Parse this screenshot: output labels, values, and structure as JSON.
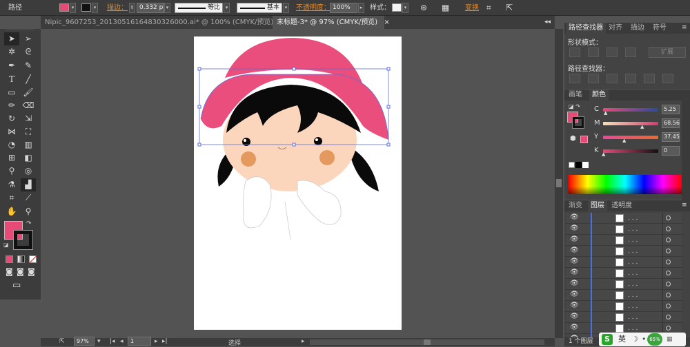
{
  "control_bar": {
    "object_type": "路径",
    "stroke_label": "描边：",
    "stroke_weight": "0.332 p",
    "profile_label": "等比",
    "brush_label": "基本",
    "opacity_label": "不透明度：",
    "opacity_value": "100%",
    "style_label": "样式：",
    "transform_label": "变换",
    "fill_color": "#e84a78"
  },
  "document_tabs": [
    {
      "label": "Nipic_9607253_20130516164830326000.ai* @ 100% (CMYK/预览)",
      "close": "×"
    },
    {
      "label": "未标题-3* @ 97% (CMYK/预览)",
      "close": "×"
    }
  ],
  "pathfinder_panel": {
    "tabs": [
      "路径查找器",
      "对齐",
      "描边",
      "符号"
    ],
    "shape_modes_label": "形状模式：",
    "expand_label": "扩展",
    "pathfinders_label": "路径查找器："
  },
  "color_panel": {
    "tabs": [
      "画笔",
      "颜色"
    ],
    "fill_color": "#e84a78",
    "channels": [
      {
        "name": "C",
        "value": "5.25",
        "unit": "%"
      },
      {
        "name": "M",
        "value": "68.56",
        "unit": "%"
      },
      {
        "name": "Y",
        "value": "37.45",
        "unit": "%"
      },
      {
        "name": "K",
        "value": "0",
        "unit": "%"
      }
    ]
  },
  "layers_panel": {
    "tabs": [
      "渐变",
      "图层",
      "透明度"
    ],
    "rows": [
      ". . .",
      ". . .",
      ". . .",
      ". . .",
      ". . .",
      ". . .",
      ". . .",
      ". . .",
      ". . .",
      ". . .",
      ". . .",
      ". . ."
    ],
    "footer": "1 个图层"
  },
  "status_bar": {
    "zoom": "97%",
    "page": "1",
    "mode": "选择"
  },
  "system_tray": {
    "ime_label": "英",
    "battery": "65%"
  }
}
